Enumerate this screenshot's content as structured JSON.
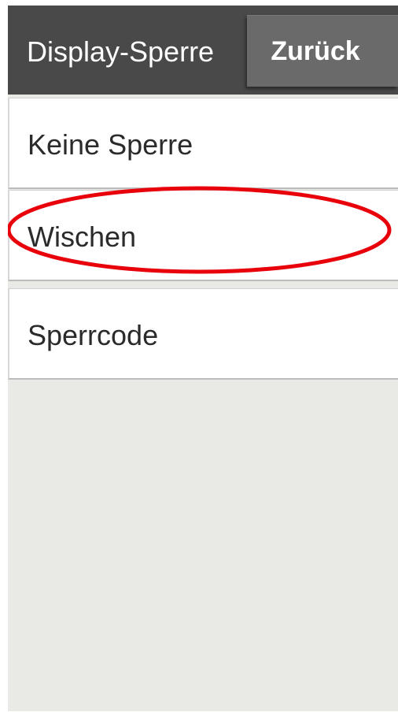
{
  "header": {
    "title": "Display-Sperre",
    "back_label": "Zurück"
  },
  "lock_options": [
    {
      "label": "Keine Sperre"
    },
    {
      "label": "Wischen"
    },
    {
      "label": "Sperrcode"
    }
  ],
  "colors": {
    "header_bg": "#494949",
    "back_button_bg": "#6a6a6a",
    "list_bg": "#e9e9e5",
    "highlight_ring": "#e8000b"
  }
}
